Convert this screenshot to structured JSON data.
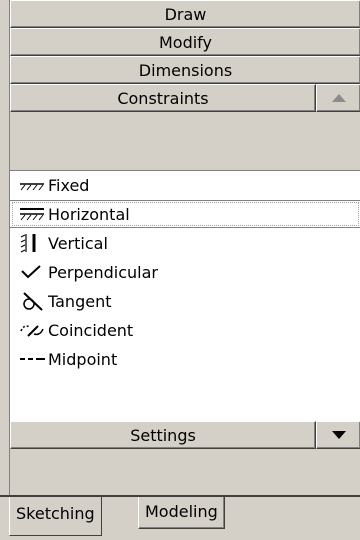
{
  "panel": {
    "sections": [
      {
        "label": "Draw"
      },
      {
        "label": "Modify"
      },
      {
        "label": "Dimensions"
      },
      {
        "label": "Constraints"
      }
    ],
    "constraints": {
      "items": [
        {
          "label": "Fixed",
          "icon": "fixed-icon"
        },
        {
          "label": "Horizontal",
          "icon": "horizontal-icon"
        },
        {
          "label": "Vertical",
          "icon": "vertical-icon"
        },
        {
          "label": "Perpendicular",
          "icon": "perpendicular-icon"
        },
        {
          "label": "Tangent",
          "icon": "tangent-icon"
        },
        {
          "label": "Coincident",
          "icon": "coincident-icon"
        },
        {
          "label": "Midpoint",
          "icon": "midpoint-icon"
        }
      ],
      "selected": "Horizontal"
    },
    "settings": {
      "label": "Settings"
    }
  },
  "tabs": [
    {
      "label": "Sketching",
      "active": true
    },
    {
      "label": "Modeling",
      "active": false
    }
  ]
}
